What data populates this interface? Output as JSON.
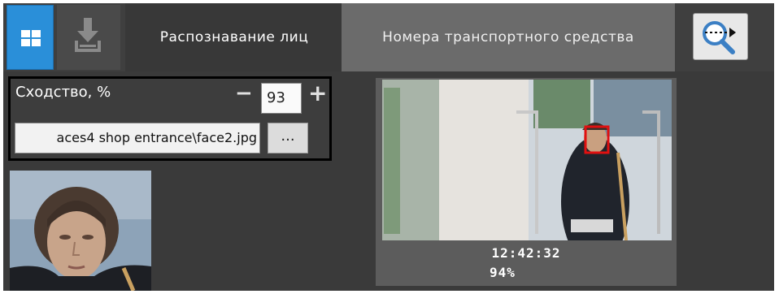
{
  "toolbar": {
    "tabs": [
      {
        "label": "Распознавание лиц"
      },
      {
        "label": "Номера транспортного средства"
      }
    ]
  },
  "search_panel": {
    "similarity_label": "Сходство, %",
    "similarity_value": "93",
    "file_path_value": "aces4 shop entrance\\face2.jpg",
    "browse_label": "..."
  },
  "result": {
    "time": "12:42:32",
    "similarity": "94%"
  },
  "icons": {
    "layout": "grid-icon",
    "export": "download-tray-icon",
    "search": "magnifier-arrow-icon",
    "decrease": "minus-icon",
    "increase": "plus-icon"
  },
  "colors": {
    "accent": "#2a8fd9",
    "active_tab": "#6b6b6b",
    "face_box": "#e01010"
  }
}
